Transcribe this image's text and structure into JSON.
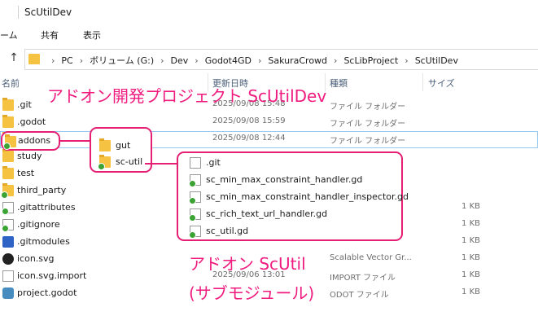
{
  "window": {
    "title": "ScUtilDev"
  },
  "ribbon": {
    "tabs": [
      "ーム",
      "共有",
      "表示"
    ]
  },
  "address": {
    "crumbs": [
      "PC",
      "ボリューム (G:)",
      "Dev",
      "Godot4GD",
      "SakuraCrowd",
      "ScLibProject",
      "ScUtilDev"
    ]
  },
  "columns": {
    "name": "名前",
    "date": "更新日時",
    "type": "種類",
    "size": "サイズ"
  },
  "files": [
    {
      "name": ".git",
      "date": "2025/09/08 15:48",
      "type": "ファイル フォルダー",
      "size": "",
      "icon": "folder-icon"
    },
    {
      "name": ".godot",
      "date": "2025/09/08 15:59",
      "type": "ファイル フォルダー",
      "size": "",
      "icon": "folder-icon"
    },
    {
      "name": "addons",
      "date": "2025/09/08 12:44",
      "type": "ファイル フォルダー",
      "size": "",
      "icon": "folder-git-icon"
    },
    {
      "name": "study",
      "date": "",
      "type": "",
      "size": "",
      "icon": "folder-icon"
    },
    {
      "name": "test",
      "date": "",
      "type": "",
      "size": "",
      "icon": "folder-icon"
    },
    {
      "name": "third_party",
      "date": "",
      "type": "",
      "size": "",
      "icon": "folder-git-icon"
    },
    {
      "name": ".gitattributes",
      "date": "",
      "type": "",
      "size": "1 KB",
      "icon": "git-file-icon"
    },
    {
      "name": ".gitignore",
      "date": "",
      "type": "",
      "size": "1 KB",
      "icon": "git-file-icon"
    },
    {
      "name": ".gitmodules",
      "date": "",
      "type": "",
      "size": "1 KB",
      "icon": "module-file-icon"
    },
    {
      "name": "icon.svg",
      "date": "",
      "type": "Scalable Vector Gr...",
      "size": "1 KB",
      "icon": "svg-file-icon"
    },
    {
      "name": "icon.svg.import",
      "date": "2025/09/06 13:01",
      "type": "IMPORT ファイル",
      "size": "1 KB",
      "icon": "file-icon"
    },
    {
      "name": "project.godot",
      "date": "",
      "type": "ODOT ファイル",
      "size": "1 KB",
      "icon": "godot-file-icon"
    }
  ],
  "annotations": {
    "top_title": "アドオン開発プロジェクト ScUtilDev",
    "bottom_title_line1": "アドオン ScUtil",
    "bottom_title_line2": "(サブモジュール)",
    "addons_label": "addons",
    "addons_children": [
      {
        "name": "gut",
        "icon": "folder-icon"
      },
      {
        "name": "sc-util",
        "icon": "folder-git-icon"
      }
    ],
    "scutil_children": [
      {
        "name": ".git",
        "icon": "file-icon"
      },
      {
        "name": "sc_min_max_constraint_handler.gd",
        "icon": "gd-script-icon"
      },
      {
        "name": "sc_min_max_constraint_handler_inspector.gd",
        "icon": "gd-script-icon"
      },
      {
        "name": "sc_rich_text_url_handler.gd",
        "icon": "gd-script-icon"
      },
      {
        "name": "sc_util.gd",
        "icon": "gd-script-icon"
      }
    ]
  },
  "colors": {
    "accent_pink": "#e51f73",
    "folder_yellow": "#f5c341",
    "git_green": "#3aa334"
  }
}
